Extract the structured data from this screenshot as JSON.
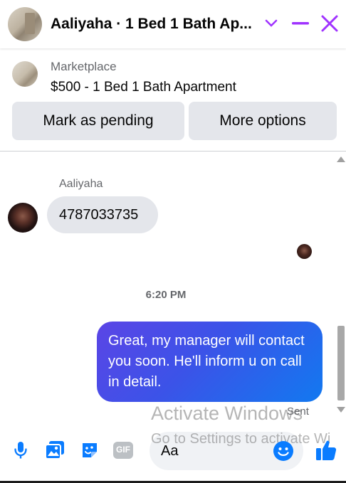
{
  "header": {
    "title": "Aaliyaha · 1 Bed 1 Bath Ap...",
    "icons": [
      "chevron-down-icon",
      "minimize-icon",
      "close-icon"
    ],
    "accent_color": "#a033ff"
  },
  "listing": {
    "label": "Marketplace",
    "title": "$500 - 1 Bed 1 Bath Apartment",
    "buttons": {
      "pending": "Mark as pending",
      "more": "More options"
    }
  },
  "messages": {
    "sender_name": "Aaliyaha",
    "incoming_text": "4787033735",
    "timestamp": "6:20 PM",
    "outgoing_text": "Great, my manager will contact you soon. He'll inform u on call in detail.",
    "status": "Sent"
  },
  "watermark": {
    "line1": "Activate Windows",
    "line2": "Go to Settings to activate Wi"
  },
  "composer": {
    "placeholder": "Aa",
    "icons": [
      "microphone-icon",
      "photo-icon",
      "sticker-icon",
      "gif-icon",
      "emoji-icon",
      "like-icon"
    ],
    "gif_label": "GIF",
    "accent_color": "#0a7cff"
  }
}
